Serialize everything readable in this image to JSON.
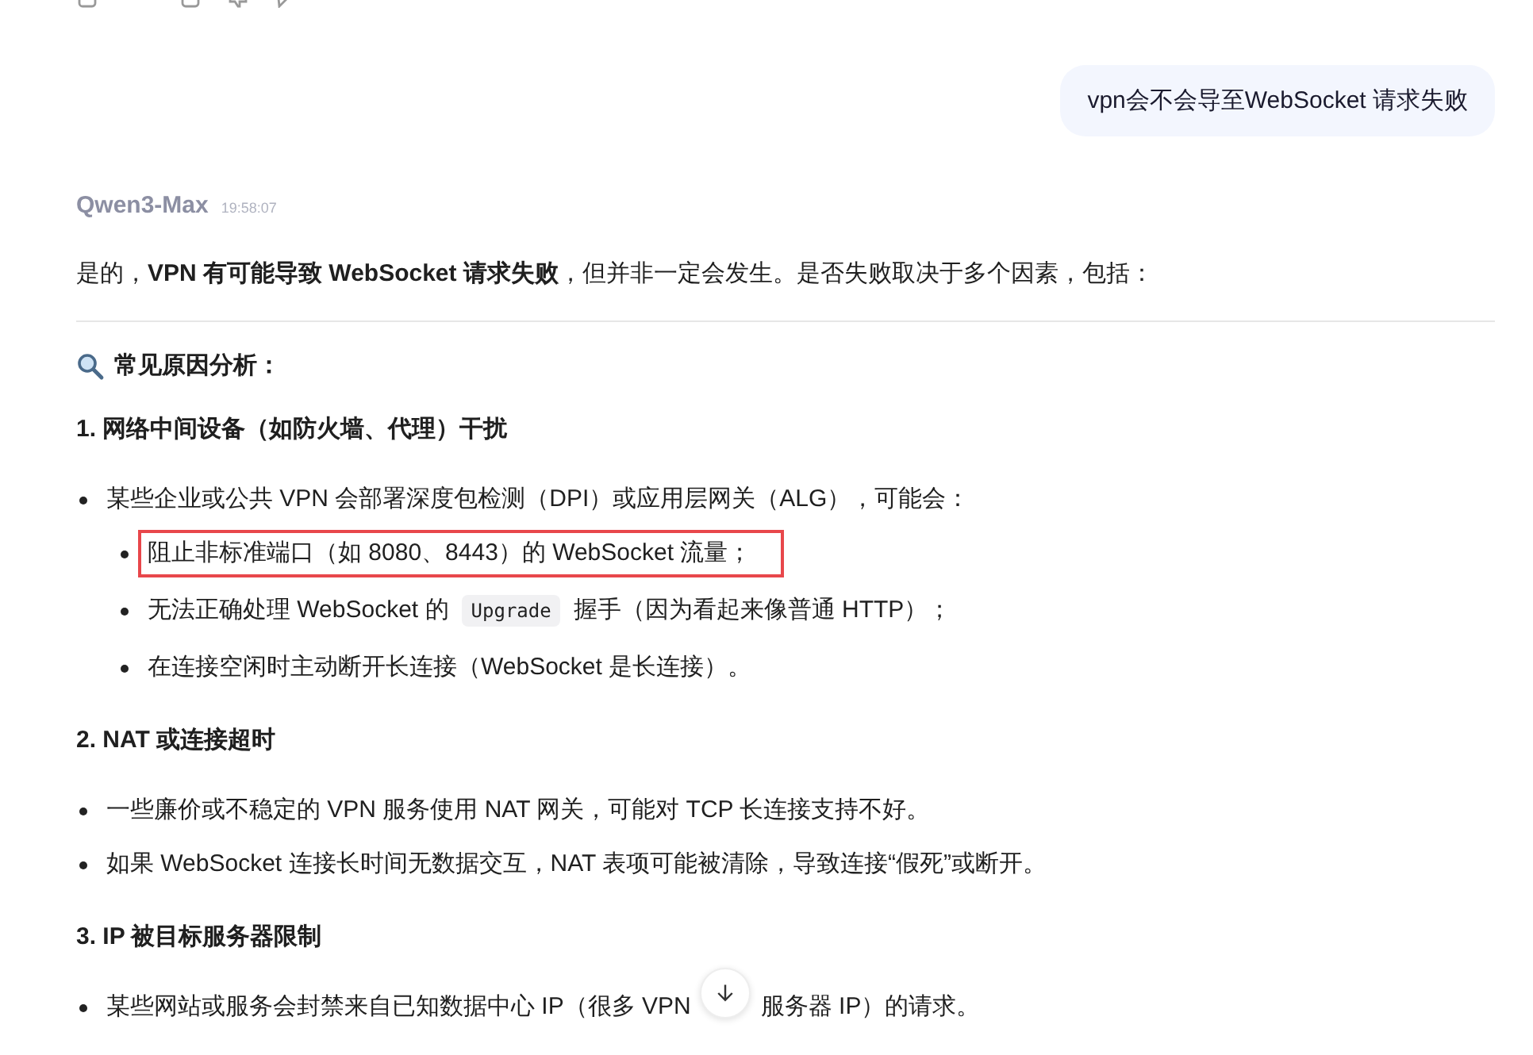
{
  "user_message": {
    "text": "vpn会不会导至WebSocket 请求失败"
  },
  "reply": {
    "model": "Qwen3-Max",
    "time": "19:58:07",
    "intro": "是的，**VPN 有可能导致 WebSocket 请求失败**，但并非一定会发生。是否失败取决于多个因素，包括：",
    "section_title": "常见原因分析：",
    "sections": [
      {
        "heading": "1. 网络中间设备（如防火墙、代理）干扰",
        "items": [
          {
            "parts": [
              {
                "kind": "text",
                "text": "某些企业或公共 VPN 会部署深度包检测（DPI）或应用层网关（ALG），可能会："
              }
            ],
            "highlighted": false,
            "children": [
              {
                "parts": [
                  {
                    "kind": "text",
                    "text": "阻止非标准端口（如 8080、8443）的 WebSocket 流量；"
                  }
                ],
                "highlighted": true
              },
              {
                "parts": [
                  {
                    "kind": "text",
                    "text": "无法正确处理 WebSocket 的"
                  },
                  {
                    "kind": "code",
                    "text": "Upgrade"
                  },
                  {
                    "kind": "text",
                    "text": "握手（因为看起来像普通 HTTP）；"
                  }
                ],
                "highlighted": false
              },
              {
                "parts": [
                  {
                    "kind": "text",
                    "text": "在连接空闲时主动断开长连接（WebSocket 是长连接）。"
                  }
                ],
                "highlighted": false
              }
            ]
          }
        ]
      },
      {
        "heading": "2. NAT 或连接超时",
        "items": [
          {
            "parts": [
              {
                "kind": "text",
                "text": "一些廉价或不稳定的 VPN 服务使用 NAT 网关，可能对 TCP 长连接支持不好。"
              }
            ],
            "highlighted": false
          },
          {
            "parts": [
              {
                "kind": "text",
                "text": "如果 WebSocket 连接长时间无数据交互，NAT 表项可能被清除，导致连接“假死”或断开。"
              }
            ],
            "highlighted": false
          }
        ]
      },
      {
        "heading": "3. IP 被目标服务器限制",
        "items": [
          {
            "parts": [
              {
                "kind": "text",
                "text": "某些网站或服务会封禁来自已知数据中心 IP（很多 VPN"
              },
              {
                "kind": "scroll_button"
              },
              {
                "kind": "text",
                "text": "服务器 IP）的请求。"
              }
            ],
            "highlighted": false
          }
        ]
      }
    ]
  }
}
